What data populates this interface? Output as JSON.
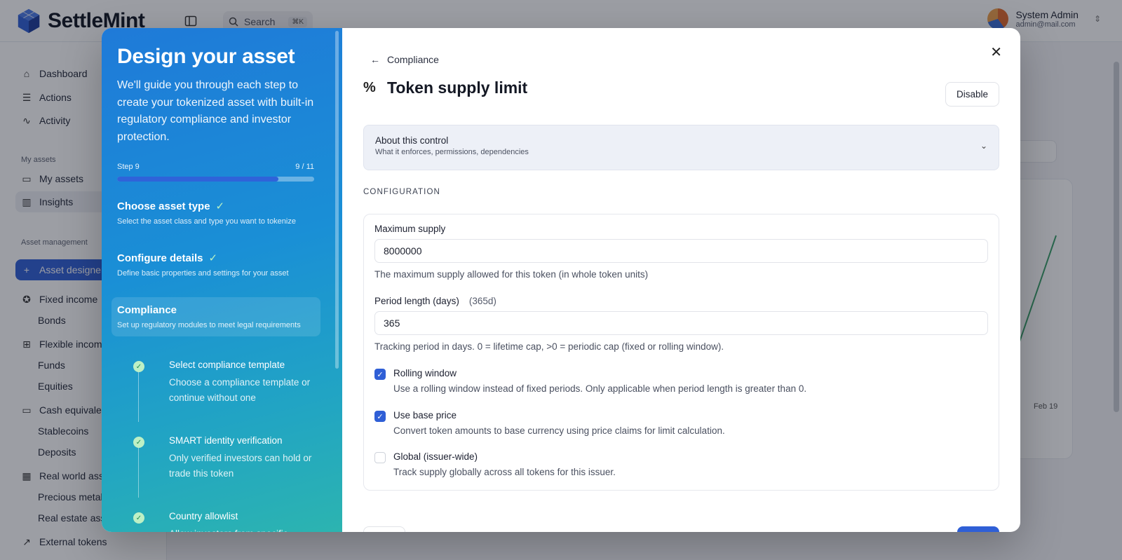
{
  "app": {
    "brand": "SettleMint",
    "search_label": "Search",
    "search_shortcut": "⌘K",
    "user": {
      "name": "System Admin",
      "email": "admin@mail.com"
    }
  },
  "sidebar": {
    "items_top": [
      {
        "label": "Dashboard",
        "icon": "home-icon"
      },
      {
        "label": "Actions",
        "icon": "list-checks-icon"
      },
      {
        "label": "Activity",
        "icon": "activity-icon"
      }
    ],
    "section_my_assets": "My assets",
    "my_assets": [
      {
        "label": "My assets",
        "icon": "wallet-icon"
      },
      {
        "label": "Insights",
        "icon": "bar-chart-icon"
      }
    ],
    "section_asset_mgmt": "Asset management",
    "asset_designer": "Asset designer",
    "groups": [
      {
        "label": "Fixed income",
        "children": [
          "Bonds"
        ]
      },
      {
        "label": "Flexible income",
        "children": [
          "Funds",
          "Equities"
        ]
      },
      {
        "label": "Cash equivalents",
        "children": [
          "Stablecoins",
          "Deposits"
        ]
      },
      {
        "label": "Real world assets",
        "children": [
          "Precious metals",
          "Real estate assets"
        ]
      }
    ],
    "external_tokens": "External tokens"
  },
  "background": {
    "chart_tick": "Feb 19"
  },
  "wizard": {
    "title": "Design your asset",
    "description": "We'll guide you through each step to create your tokenized asset with built-in regulatory compliance and investor protection.",
    "step_label": "Step 9",
    "step_count": "9 / 11",
    "progress": 0.818,
    "steps": [
      {
        "title": "Choose asset type",
        "subtitle": "Select the asset class and type you want to tokenize",
        "done": true
      },
      {
        "title": "Configure details",
        "subtitle": "Define basic properties and settings for your asset",
        "done": true
      },
      {
        "title": "Compliance",
        "subtitle": "Set up regulatory modules to meet legal requirements",
        "done": false
      }
    ],
    "substeps": [
      {
        "title": "Select compliance template",
        "desc": "Choose a compliance template or continue without one"
      },
      {
        "title": "SMART identity verification",
        "desc": "Only verified investors can hold or trade this token"
      },
      {
        "title": "Country allowlist",
        "desc": "Allow investors from specific"
      }
    ]
  },
  "panel": {
    "back_label": "Compliance",
    "title": "Token supply limit",
    "disable_label": "Disable",
    "about_title": "About this control",
    "about_sub": "What it enforces, permissions, dependencies",
    "config_heading": "CONFIGURATION",
    "max_supply_label": "Maximum supply",
    "max_supply_value": "8000000",
    "max_supply_help": "The maximum supply allowed for this token (in whole token units)",
    "period_label": "Period length (days)",
    "period_hint": "(365d)",
    "period_value": "365",
    "period_help": "Tracking period in days. 0 = lifetime cap, >0 = periodic cap (fixed or rolling window).",
    "options": [
      {
        "title": "Rolling window",
        "desc": "Use a rolling window instead of fixed periods. Only applicable when period length is greater than 0.",
        "checked": true
      },
      {
        "title": "Use base price",
        "desc": "Convert token amounts to base currency using price claims for limit calculation.",
        "checked": true
      },
      {
        "title": "Global (issuer-wide)",
        "desc": "Track supply globally across all tokens for this issuer.",
        "checked": false
      }
    ]
  },
  "colors": {
    "accent": "#2f5fd6",
    "gradient_start": "#1f7ad8",
    "gradient_end": "#2cb4b0",
    "check_green": "#bdf0c5"
  }
}
